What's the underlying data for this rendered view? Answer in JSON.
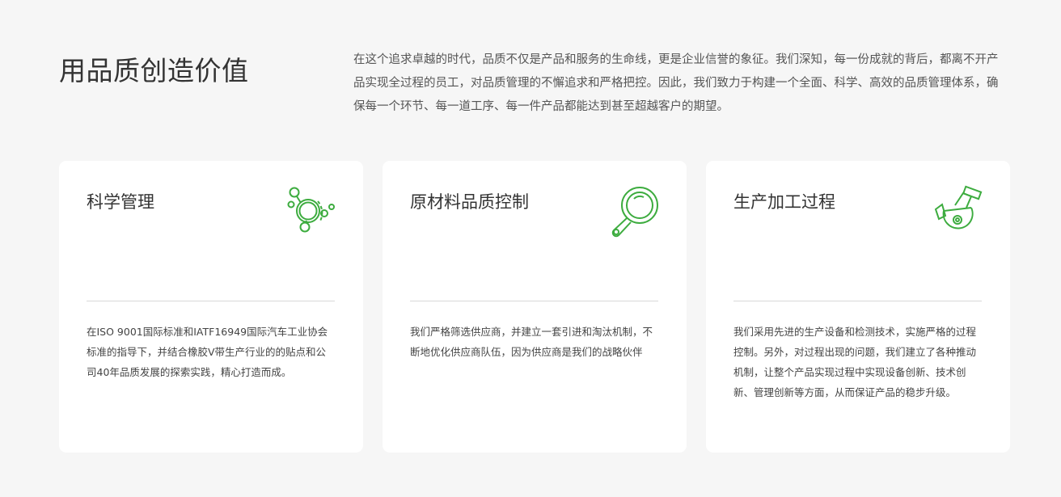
{
  "header": {
    "title": "用品质创造价值",
    "intro": "在这个追求卓越的时代，品质不仅是产品和服务的生命线，更是企业信誉的象征。我们深知，每一份成就的背后，都离不开产品实现全过程的员工，对品质管理的不懈追求和严格把控。因此，我们致力于构建一个全面、科学、高效的品质管理体系，确保每一个环节、每一道工序、每一件产品都能达到甚至超越客户的期望。"
  },
  "cards": [
    {
      "title": "科学管理",
      "icon": "molecule-icon",
      "description": "在ISO 9001国际标准和IATF16949国际汽车工业协会标准的指导下，并结合橡胶V带生产行业的的贴点和公司40年品质发展的探索实践，精心打造而成。"
    },
    {
      "title": "原材料品质控制",
      "icon": "magnifier-icon",
      "description": "我们严格筛选供应商，并建立一套引进和淘汰机制，不断地优化供应商队伍，因为供应商是我们的战略伙伴"
    },
    {
      "title": "生产加工过程",
      "icon": "grinder-icon",
      "description": "我们采用先进的生产设备和检测技术，实施严格的过程控制。另外，对过程出现的问题，我们建立了各种推动机制，让整个产品实现过程中实现设备创新、技术创新、管理创新等方面，从而保证产品的稳步升级。"
    }
  ],
  "colors": {
    "accent": "#3dac3f",
    "background": "#f6f6f6",
    "card": "#ffffff"
  }
}
